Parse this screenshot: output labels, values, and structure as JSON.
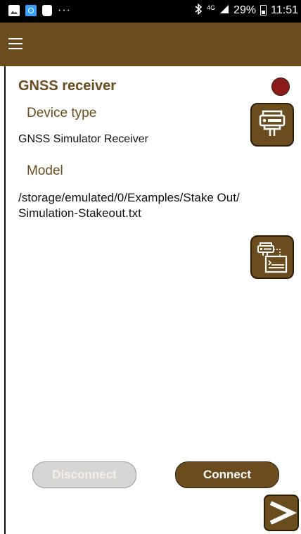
{
  "status_bar": {
    "overflow": "···",
    "network": "4G",
    "battery": "29%",
    "time": "11:51"
  },
  "icons": {
    "menu": "hamburger-menu-icon",
    "status_indicator": "status-indicator-icon",
    "device_type": "receiver-device-icon",
    "model": "receiver-to-file-icon",
    "next": "chevron-right-icon"
  },
  "page": {
    "title": "GNSS receiver",
    "status_color": "#8b1a1a",
    "device_type_label": "Device type",
    "device_type_value": "GNSS Simulator Receiver",
    "model_label": "Model",
    "model_value_line1": "/storage/emulated/0/Examples/Stake Out/",
    "model_value_line2": "Simulation-Stakeout.txt"
  },
  "actions": {
    "disconnect_label": "Disconnect",
    "connect_label": "Connect"
  },
  "colors": {
    "accent": "#6b4c1f",
    "status_red": "#8b1a1a"
  }
}
